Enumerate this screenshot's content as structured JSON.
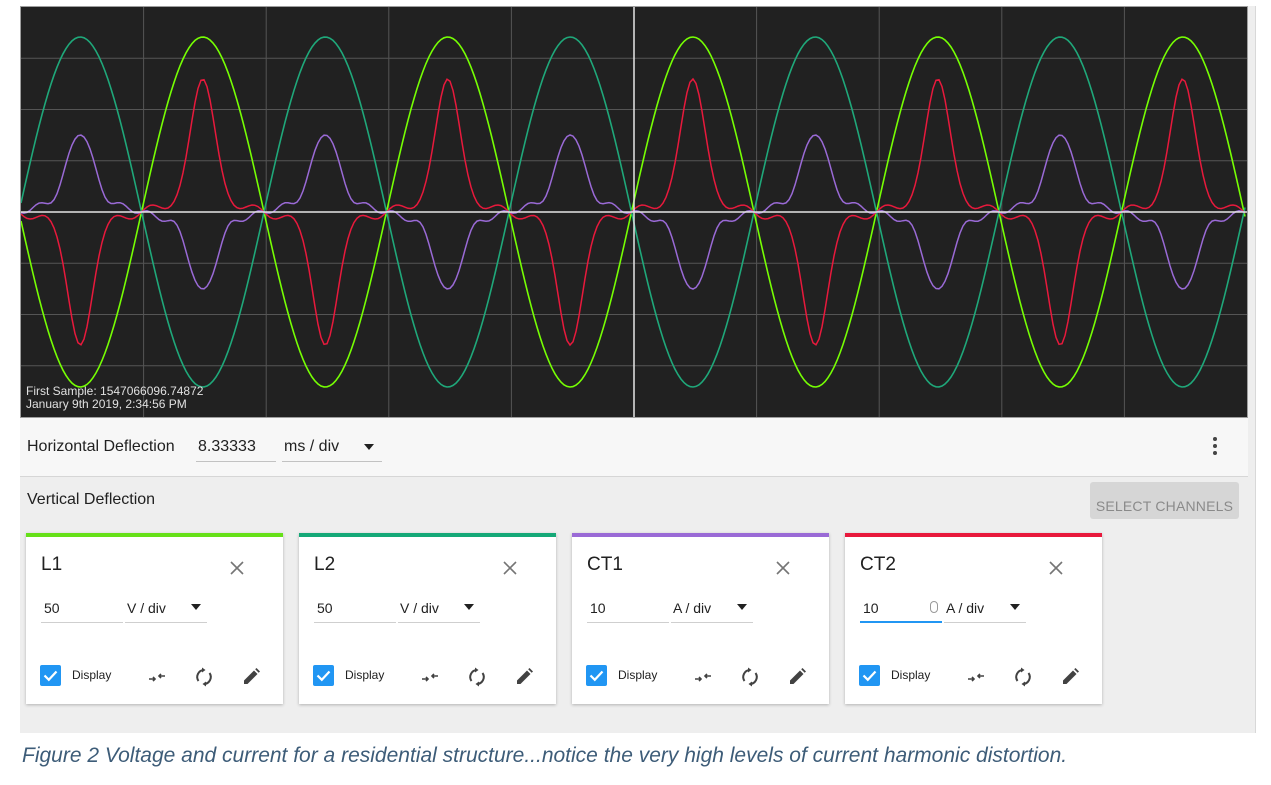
{
  "scope": {
    "first_sample_line1": "First Sample: 1547066096.74872",
    "first_sample_line2": "January 9th 2019, 2:34:56 PM",
    "colors": {
      "background": "#212121",
      "grid": "#555555",
      "axis": "#e6e6e6",
      "L1": "#76ff03",
      "L2": "#1fa87a",
      "CT1": "#9a6ad6",
      "CT2": "#e8193c"
    }
  },
  "horizontal": {
    "label": "Horizontal Deflection",
    "value": "8.33333",
    "unit": "ms / div",
    "menu_icon": "more-vert-icon"
  },
  "vertical": {
    "label": "Vertical Deflection",
    "select_channels": "SELECT CHANNELS"
  },
  "channels": [
    {
      "name": "L1",
      "value": "50",
      "unit": "V / div",
      "color": "#66e018",
      "display_label": "Display",
      "display_checked": true
    },
    {
      "name": "L2",
      "value": "50",
      "unit": "V / div",
      "color": "#14a877",
      "display_label": "Display",
      "display_checked": true
    },
    {
      "name": "CT1",
      "value": "10",
      "unit": "A / div",
      "color": "#9a6ad6",
      "display_label": "Display",
      "display_checked": true
    },
    {
      "name": "CT2",
      "value": "10",
      "unit": "A / div",
      "color": "#e8193c",
      "display_label": "Display",
      "display_checked": true
    }
  ],
  "caption": "Figure 2 Voltage and current for a residential structure...notice the very high levels of current harmonic distortion."
}
